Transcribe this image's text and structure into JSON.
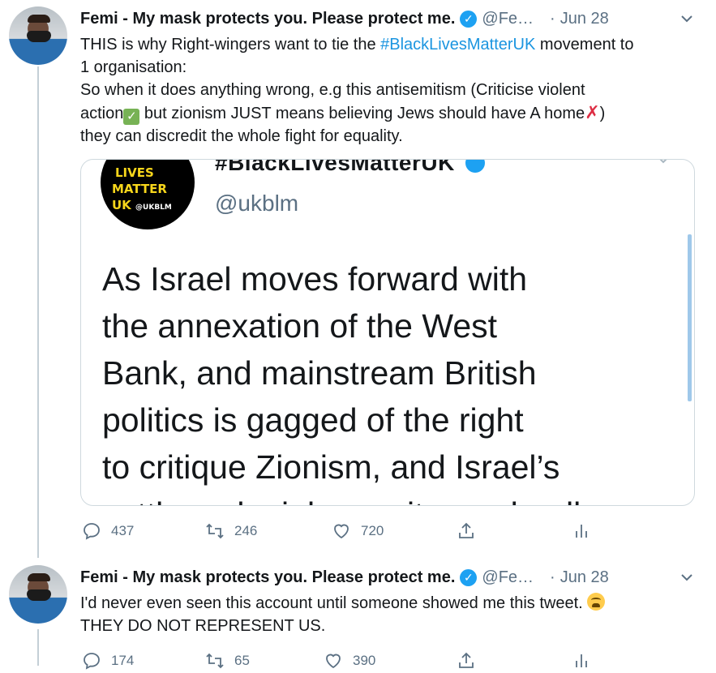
{
  "tweets": [
    {
      "author_name": "Femi - My mask protects you. Please protect me.",
      "verified_mark": "✓",
      "handle": "@Fe…",
      "separator": "·",
      "date": "Jun 28",
      "text_line1_a": "THIS is why Right-wingers want to tie the ",
      "hashtag": "#BlackLivesMatterUK",
      "text_line1_b": " movement to",
      "text_line2": "1 organisation:",
      "text_line3": "So when it does anything wrong, e.g this antisemitism (Criticise violent",
      "text_line4_a": "action",
      "text_line4_b": " but zionism JUST means believing Jews should have A home",
      "text_line4_c": ")",
      "text_line5": "they can discredit the whole fight for equality.",
      "check_emoji": "✓",
      "cross_emoji": "✗",
      "embedded": {
        "logo_line1": "LIVES",
        "logo_line2": "MATTER",
        "logo_line3": "UK",
        "logo_handle": "@UKBLM",
        "account_name": "#BlackLivesMatterUK",
        "account_handle": "@ukblm",
        "quote_lines": [
          "As Israel moves forward with",
          "the annexation of the West",
          "Bank, and mainstream British",
          "politics is gagged of the right",
          "to critique Zionism, and Israel’s",
          "settler colonial pursuits, we loudly"
        ]
      },
      "replies": "437",
      "retweets": "246",
      "likes": "720"
    },
    {
      "author_name": "Femi - My mask protects you. Please protect me.",
      "verified_mark": "✓",
      "handle": "@Fe…",
      "separator": "·",
      "date": "Jun 28",
      "text_line1": "I'd never even seen this account until someone showed me this tweet.",
      "text_line2": "THEY DO NOT REPRESENT US.",
      "replies": "174",
      "retweets": "65",
      "likes": "390"
    }
  ],
  "colors": {
    "accent": "#1da1f2",
    "hashtag": "#1b95e0",
    "muted": "#5b7083",
    "thread_line": "#c4cfd6"
  },
  "icons": {
    "reply": "reply-icon",
    "retweet": "retweet-icon",
    "like": "heart-icon",
    "share": "share-icon",
    "analytics": "analytics-icon",
    "more": "chevron-down-icon"
  }
}
